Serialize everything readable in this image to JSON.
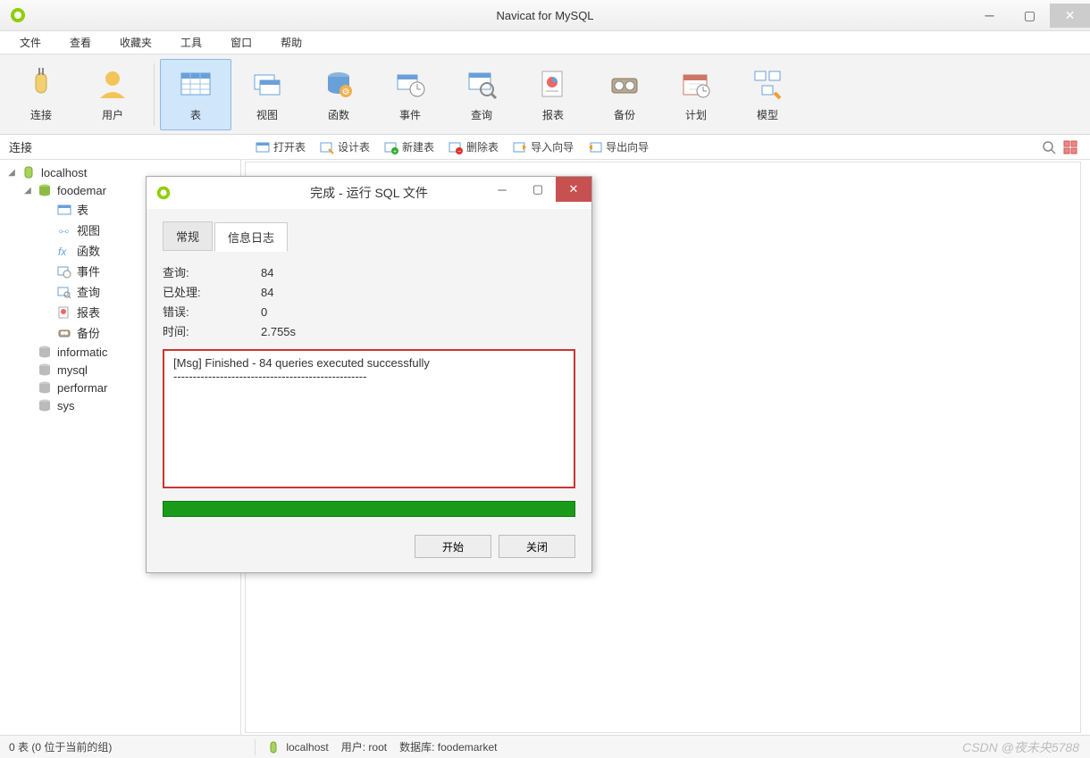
{
  "app": {
    "title": "Navicat for MySQL"
  },
  "menu": {
    "items": [
      "文件",
      "查看",
      "收藏夹",
      "工具",
      "窗口",
      "帮助"
    ]
  },
  "toolbar": {
    "group1": [
      {
        "label": "连接",
        "icon": "plug-icon"
      },
      {
        "label": "用户",
        "icon": "user-icon"
      }
    ],
    "group2": [
      {
        "label": "表",
        "icon": "table-icon",
        "active": true
      },
      {
        "label": "视图",
        "icon": "view-icon"
      },
      {
        "label": "函数",
        "icon": "function-icon"
      },
      {
        "label": "事件",
        "icon": "event-icon"
      },
      {
        "label": "查询",
        "icon": "query-icon"
      },
      {
        "label": "报表",
        "icon": "report-icon"
      },
      {
        "label": "备份",
        "icon": "backup-icon"
      },
      {
        "label": "计划",
        "icon": "schedule-icon"
      },
      {
        "label": "模型",
        "icon": "model-icon"
      }
    ]
  },
  "sub_toolbar": {
    "left_header": "连接",
    "buttons": [
      {
        "label": "打开表",
        "icon": "open-table-icon"
      },
      {
        "label": "设计表",
        "icon": "design-table-icon"
      },
      {
        "label": "新建表",
        "icon": "new-table-icon"
      },
      {
        "label": "删除表",
        "icon": "delete-table-icon"
      },
      {
        "label": "导入向导",
        "icon": "import-wizard-icon"
      },
      {
        "label": "导出向导",
        "icon": "export-wizard-icon"
      }
    ]
  },
  "tree": {
    "root": {
      "label": "localhost",
      "db": {
        "label": "foodemar",
        "children": [
          {
            "label": "表",
            "icon": "table-icon"
          },
          {
            "label": "视图",
            "icon": "view-icon"
          },
          {
            "label": "函数",
            "icon": "function-icon"
          },
          {
            "label": "事件",
            "icon": "event-icon"
          },
          {
            "label": "查询",
            "icon": "query-icon"
          },
          {
            "label": "报表",
            "icon": "report-icon"
          },
          {
            "label": "备份",
            "icon": "backup-icon"
          }
        ]
      },
      "others": [
        "informatic",
        "mysql",
        "performar",
        "sys"
      ]
    }
  },
  "dialog": {
    "title": "完成 - 运行 SQL 文件",
    "tabs": {
      "general": "常规",
      "log": "信息日志"
    },
    "rows": [
      {
        "k": "查询:",
        "v": "84"
      },
      {
        "k": "已处理:",
        "v": "84"
      },
      {
        "k": "错误:",
        "v": "0"
      },
      {
        "k": "时间:",
        "v": "2.755s"
      }
    ],
    "log_line1": "[Msg] Finished - 84 queries executed successfully",
    "log_line2": "--------------------------------------------------",
    "buttons": {
      "start": "开始",
      "close": "关闭"
    }
  },
  "status": {
    "left": "0 表 (0 位于当前的组)",
    "conn": "localhost",
    "user_label": "用户:",
    "user": "root",
    "db_label": "数据库:",
    "db": "foodemarket",
    "watermark": "CSDN @夜未央5788"
  }
}
